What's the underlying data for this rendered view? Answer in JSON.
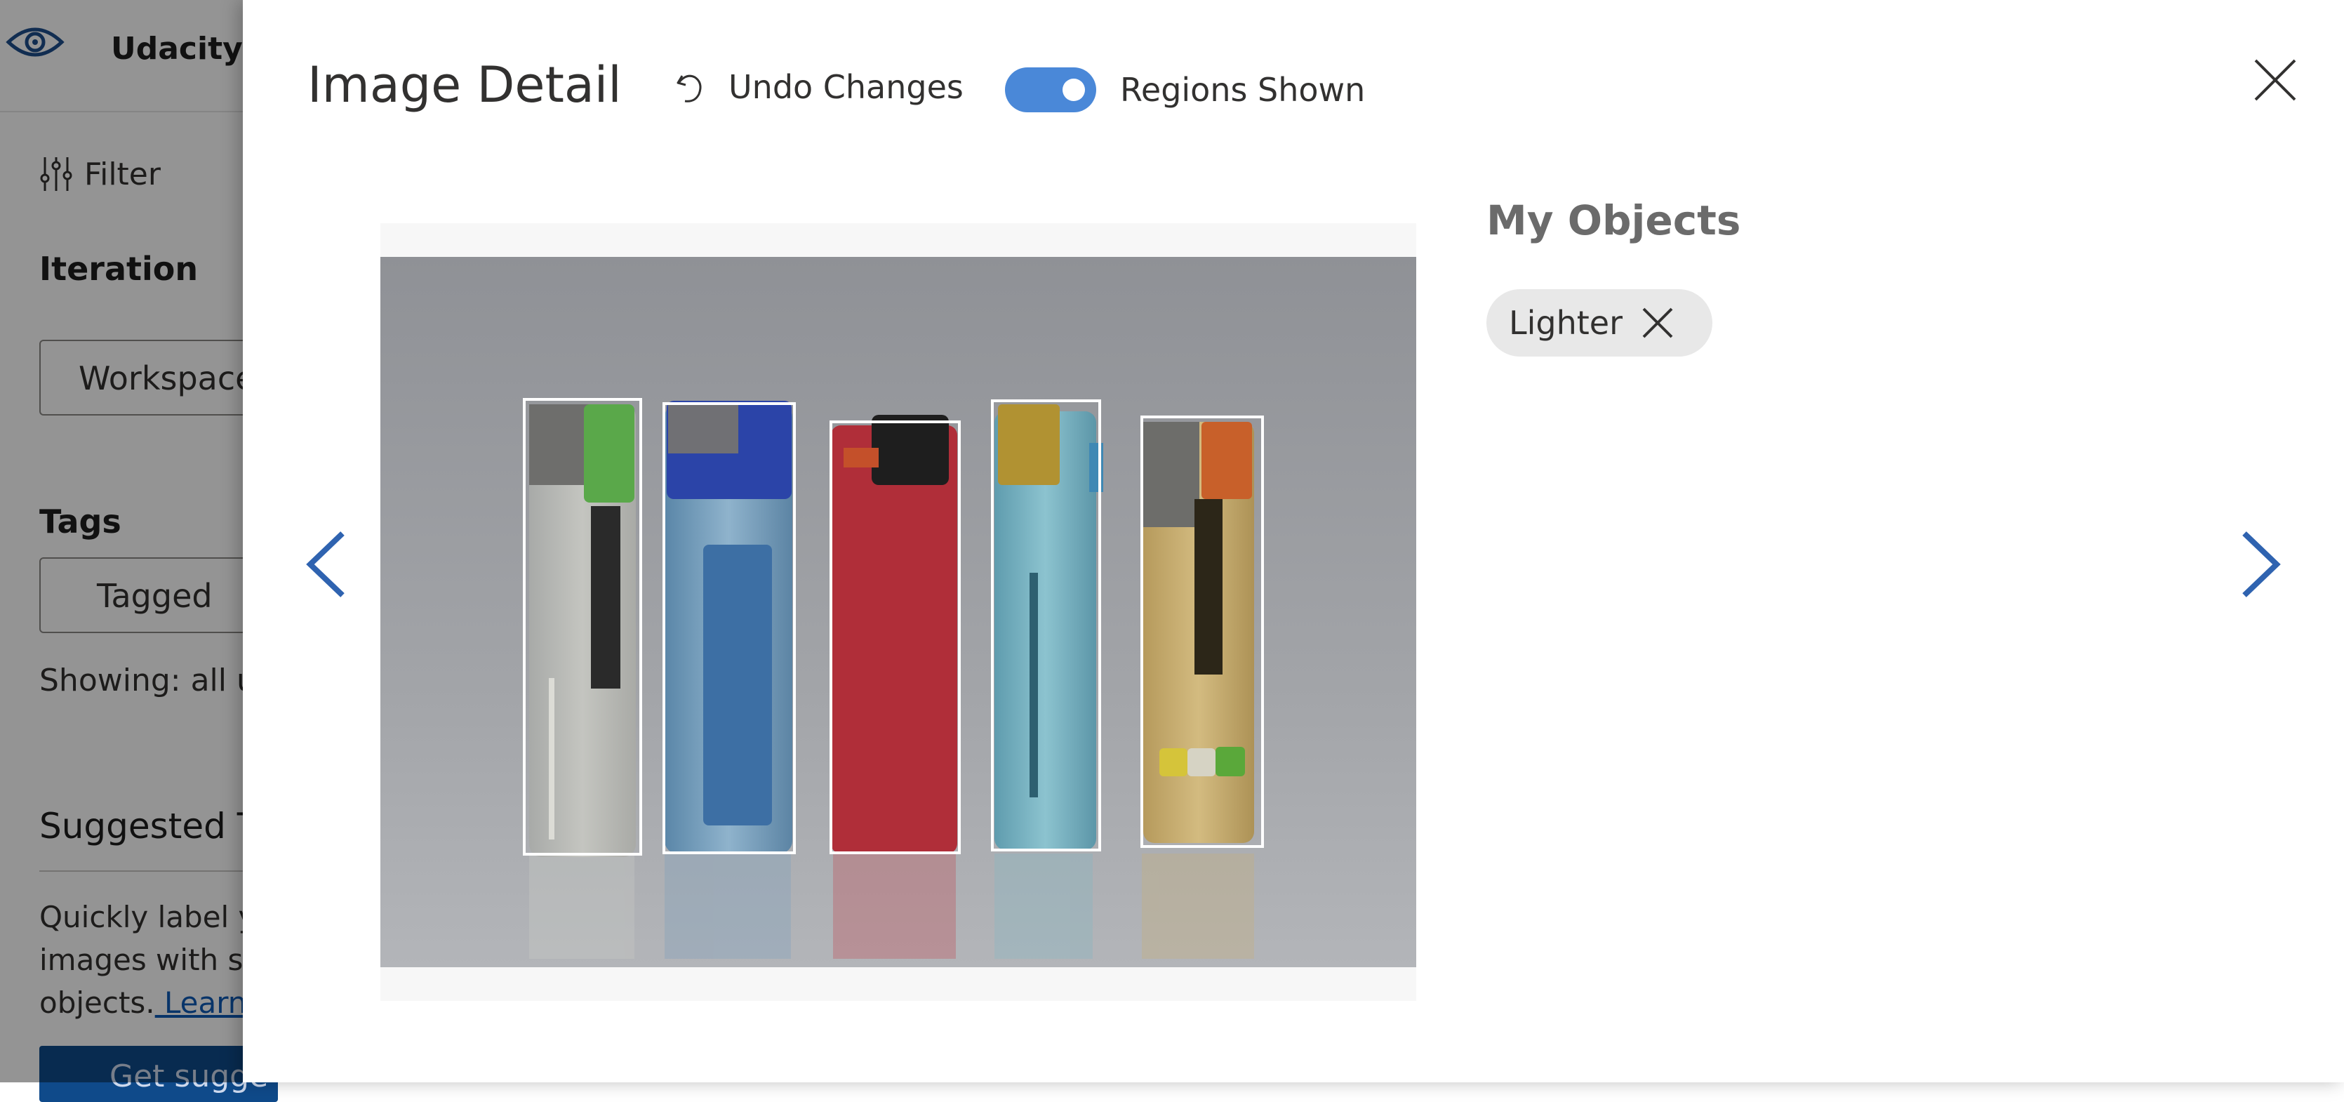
{
  "background": {
    "brand": "Udacity",
    "filter_label": "Filter",
    "iteration_heading": "Iteration",
    "iteration_value": "Workspace",
    "tags_heading": "Tags",
    "tags_value": "Tagged",
    "showing_text": "Showing: all un",
    "suggested_heading": "Suggested T",
    "suggested_para_1": "Quickly label yo",
    "suggested_para_2": "images with sug",
    "suggested_para_3": "objects.",
    "learn_more": " Learn m",
    "suggest_button": "Get sugge"
  },
  "panel": {
    "title": "Image Detail",
    "undo_label": "Undo Changes",
    "toggle_label": "Regions Shown",
    "toggle_on": true,
    "objects_heading": "My Objects",
    "tags": [
      {
        "label": "Lighter"
      }
    ]
  },
  "colors": {
    "toggle_on": "#4a88d8",
    "nav_arrow": "#2f63b0",
    "region_stroke": "#ffffff"
  }
}
